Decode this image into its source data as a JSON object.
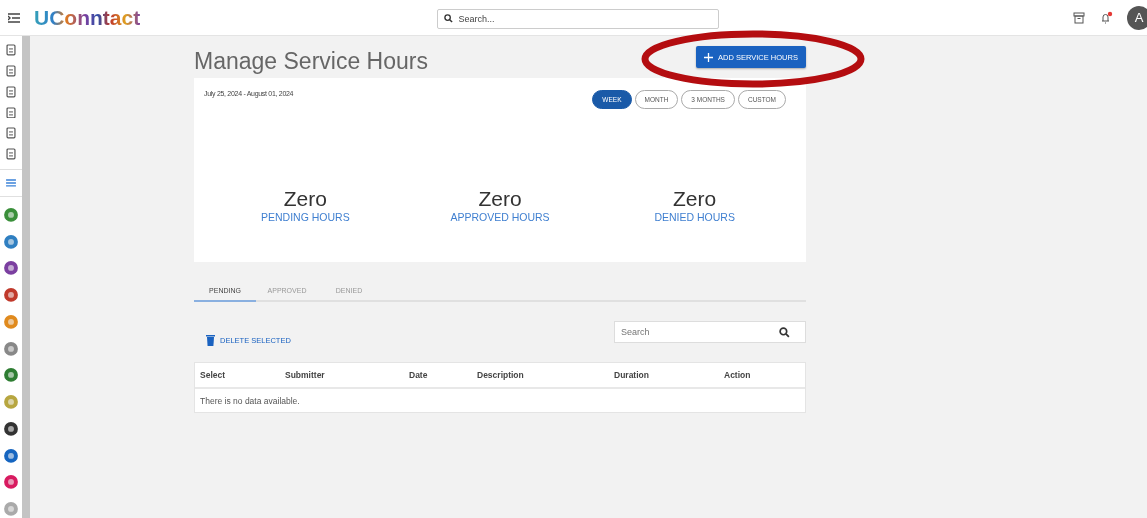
{
  "header": {
    "logo": "UConntact",
    "search": {
      "placeholder": "Search..."
    },
    "notifications": {
      "unread": true
    },
    "avatar": "A"
  },
  "page": {
    "title": "Manage Service Hours",
    "add_button": "ADD SERVICE HOURS"
  },
  "summary": {
    "date_range": "July 25, 2024 - August 01, 2024",
    "ranges": [
      {
        "label": "WEEK",
        "selected": true
      },
      {
        "label": "MONTH",
        "selected": false
      },
      {
        "label": "3 MONTHS",
        "selected": false
      },
      {
        "label": "CUSTOM",
        "selected": false
      }
    ],
    "stats": [
      {
        "value": "Zero",
        "label": "PENDING HOURS"
      },
      {
        "value": "Zero",
        "label": "APPROVED HOURS"
      },
      {
        "value": "Zero",
        "label": "DENIED HOURS"
      }
    ]
  },
  "tabs": [
    {
      "label": "PENDING",
      "selected": true
    },
    {
      "label": "APPROVED",
      "selected": false
    },
    {
      "label": "DENIED",
      "selected": false
    }
  ],
  "delete_button": "DELETE SELECTED",
  "table_search": {
    "placeholder": "Search"
  },
  "table": {
    "columns": [
      "Select",
      "Submitter",
      "Date",
      "Description",
      "Duration",
      "Action"
    ],
    "empty_message": "There is no data available."
  }
}
